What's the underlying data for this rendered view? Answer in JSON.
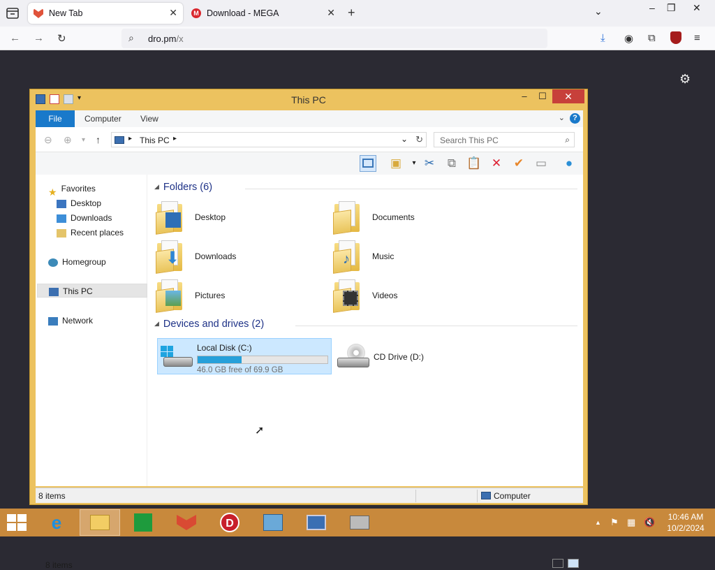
{
  "browser": {
    "tabs": [
      {
        "label": "New Tab",
        "active": true,
        "favicon": "fox-icon"
      },
      {
        "label": "Download - MEGA",
        "active": false,
        "favicon": "mega-icon"
      }
    ],
    "url_main": "dro.pm",
    "url_rest": "/x",
    "new_tab_symbol": "+",
    "close_symbol": "✕"
  },
  "explorer": {
    "title": "This PC",
    "ribbon_tabs": [
      "File",
      "Computer",
      "View"
    ],
    "breadcrumb": "This PC",
    "search_placeholder": "Search This PC",
    "nav": {
      "favorites": "Favorites",
      "desktop": "Desktop",
      "downloads": "Downloads",
      "recent": "Recent places",
      "homegroup": "Homegroup",
      "thispc": "This PC",
      "network": "Network"
    },
    "folders_header": "Folders (6)",
    "folders": [
      "Desktop",
      "Documents",
      "Downloads",
      "Music",
      "Pictures",
      "Videos"
    ],
    "devices_header": "Devices and drives (2)",
    "drive_c": {
      "label": "Local Disk (C:)",
      "free_text": "46.0 GB free of 69.9 GB",
      "used_fraction": 0.34
    },
    "drive_d": {
      "label": "CD Drive (D:)"
    },
    "items_count": "8 items",
    "status_items": "8 items",
    "status_computer": "Computer"
  },
  "taskbar": {
    "time": "10:46 AM",
    "date": "10/2/2024"
  },
  "colors": {
    "window_frame": "#ecc25f",
    "taskbar": "#c8893c",
    "file_tab": "#1979ca",
    "close_red": "#c7403a"
  }
}
